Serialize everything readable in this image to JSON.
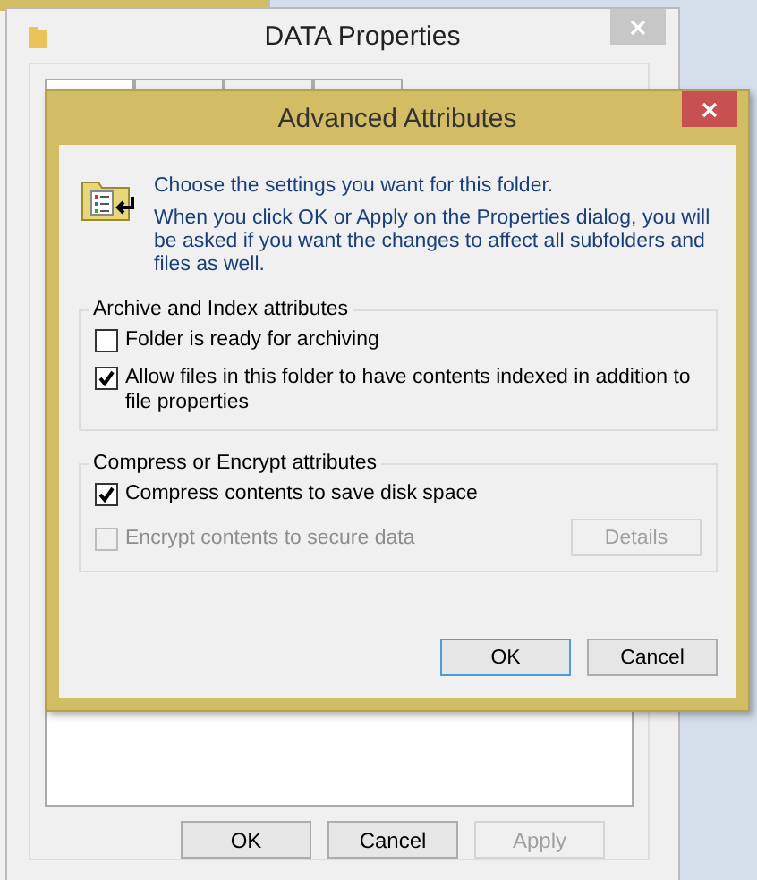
{
  "properties_window": {
    "title": "DATA Properties",
    "tabs": [
      {
        "selected": true
      },
      {
        "selected": false
      },
      {
        "selected": false
      },
      {
        "selected": false
      }
    ],
    "buttons": [
      {
        "label": "OK",
        "disabled": false
      },
      {
        "label": "Cancel",
        "disabled": false
      },
      {
        "label": "Apply",
        "disabled": true
      }
    ]
  },
  "dialog": {
    "title": "Advanced Attributes",
    "intro": "Choose the settings you want for this folder.",
    "note": "When you click OK or Apply on the Properties dialog, you will be asked if you want the changes to affect all subfolders and files as well.",
    "groups": [
      {
        "title": "Archive and Index attributes",
        "options": [
          {
            "label": "Folder is ready for archiving",
            "checked": false,
            "disabled": false
          },
          {
            "label": "Allow files in this folder to have contents indexed in addition to file properties",
            "checked": true,
            "disabled": false
          }
        ]
      },
      {
        "title": "Compress or Encrypt attributes",
        "options": [
          {
            "label": "Compress contents to save disk space",
            "checked": true,
            "disabled": false
          },
          {
            "label": "Encrypt contents to secure data",
            "checked": false,
            "disabled": true
          }
        ],
        "button": {
          "label": "Details",
          "disabled": true
        }
      }
    ],
    "buttons": [
      {
        "label": "OK",
        "default": true
      },
      {
        "label": "Cancel",
        "default": false
      }
    ]
  }
}
